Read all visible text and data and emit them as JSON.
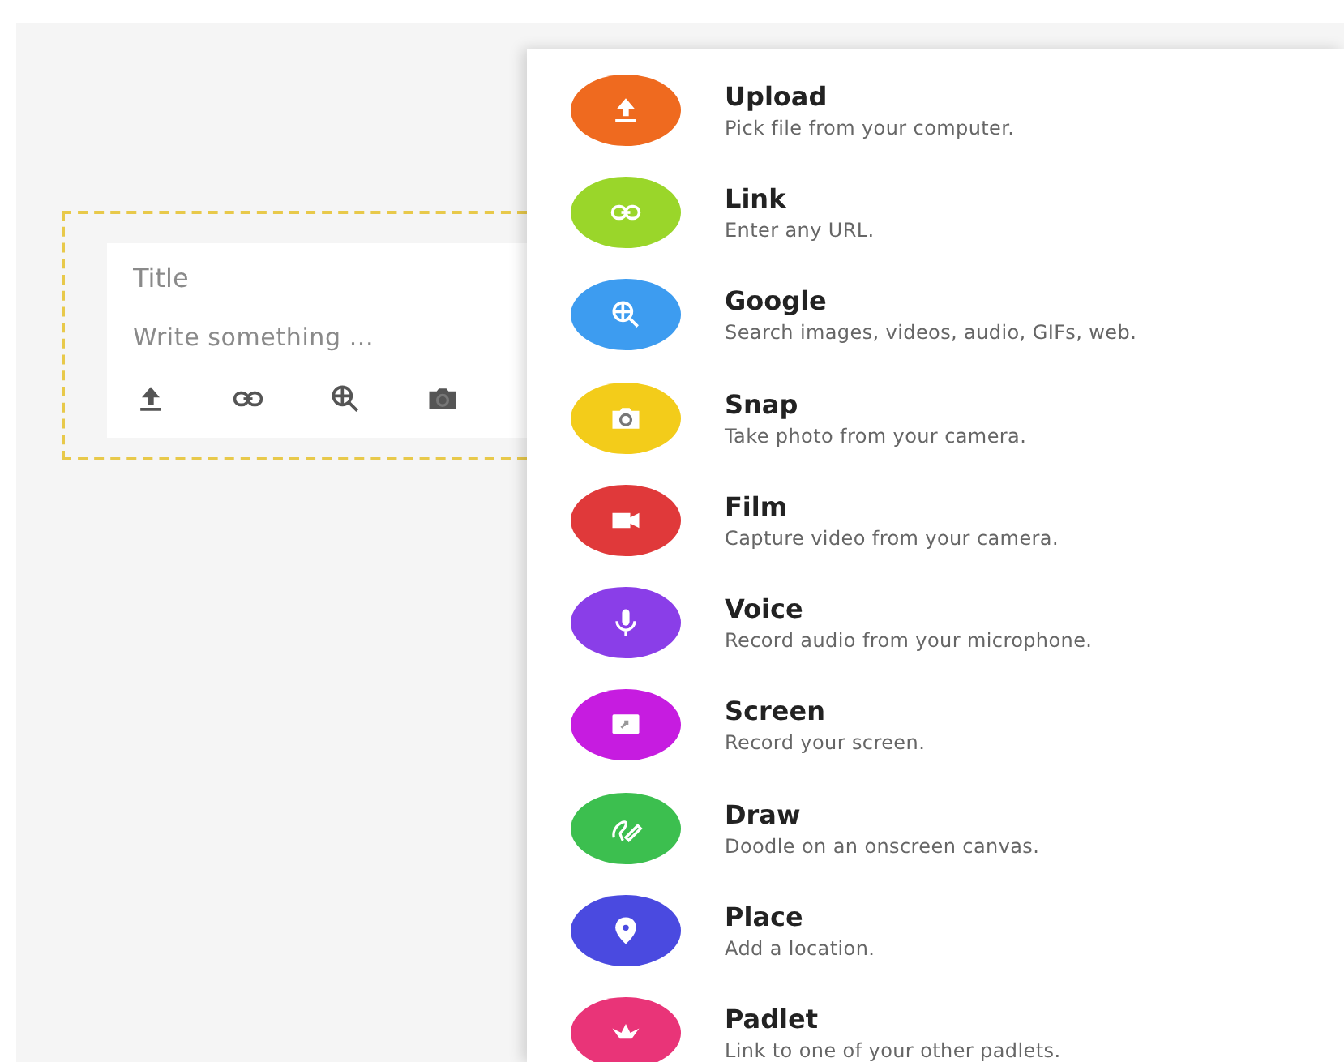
{
  "composer": {
    "title_placeholder": "Title",
    "body_placeholder": "Write something ...",
    "tools": [
      {
        "kind": "upload"
      },
      {
        "kind": "link"
      },
      {
        "kind": "google"
      },
      {
        "kind": "snap"
      }
    ]
  },
  "menu": {
    "items": [
      {
        "kind": "upload",
        "title": "Upload",
        "description": "Pick file from your computer.",
        "color": "#ef6a1f"
      },
      {
        "kind": "link",
        "title": "Link",
        "description": "Enter any URL.",
        "color": "#9ad62a"
      },
      {
        "kind": "google",
        "title": "Google",
        "description": "Search images, videos, audio, GIFs, web.",
        "color": "#3d9cf0"
      },
      {
        "kind": "snap",
        "title": "Snap",
        "description": "Take photo from your camera.",
        "color": "#f3cc1a"
      },
      {
        "kind": "film",
        "title": "Film",
        "description": "Capture video from your camera.",
        "color": "#e0393a"
      },
      {
        "kind": "voice",
        "title": "Voice",
        "description": "Record audio from your microphone.",
        "color": "#8a3ee8"
      },
      {
        "kind": "screen",
        "title": "Screen",
        "description": "Record your screen.",
        "color": "#c61ce0"
      },
      {
        "kind": "draw",
        "title": "Draw",
        "description": "Doodle on an onscreen canvas.",
        "color": "#3cbf4f"
      },
      {
        "kind": "place",
        "title": "Place",
        "description": "Add a location.",
        "color": "#4a4ae0"
      },
      {
        "kind": "padlet",
        "title": "Padlet",
        "description": "Link to one of your other padlets.",
        "color": "#e93478"
      }
    ]
  }
}
